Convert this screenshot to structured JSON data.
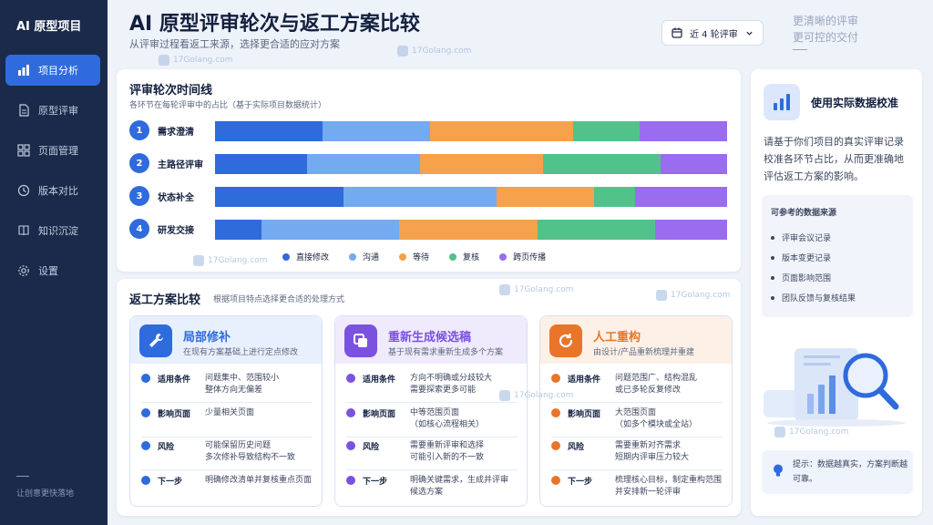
{
  "app": {
    "brand": "AI 原型项目",
    "slogan": "让创意更快落地"
  },
  "nav": [
    {
      "label": "项目分析",
      "icon": "bar-chart-icon",
      "active": true
    },
    {
      "label": "原型评审",
      "icon": "document-icon",
      "active": false
    },
    {
      "label": "页面管理",
      "icon": "grid-icon",
      "active": false
    },
    {
      "label": "版本对比",
      "icon": "history-icon",
      "active": false
    },
    {
      "label": "知识沉淀",
      "icon": "book-icon",
      "active": false
    },
    {
      "label": "设置",
      "icon": "gear-icon",
      "active": false
    }
  ],
  "header": {
    "title": "AI 原型评审轮次与返工方案比较",
    "subtitle": "从评审过程看返工来源，选择更合适的应对方案",
    "round_select": "近 4 轮评审",
    "tagline": [
      "更清晰的评审",
      "更可控的交付"
    ]
  },
  "watermark": "17Golang.com",
  "timeline": {
    "title": "评审轮次时间线",
    "subtitle": "各环节在每轮评审中的占比（基于实际项目数据统计）"
  },
  "chart_data": {
    "type": "bar",
    "stacked": true,
    "orientation": "horizontal",
    "categories": [
      "需求澄清",
      "主路径评审",
      "状态补全",
      "研发交接"
    ],
    "series": [
      {
        "name": "直接修改",
        "color": "#2f6bdc",
        "values": [
          21,
          18,
          25,
          9
        ]
      },
      {
        "name": "沟通",
        "color": "#74aaf0",
        "values": [
          21,
          22,
          30,
          27
        ]
      },
      {
        "name": "等待",
        "color": "#f6a14b",
        "values": [
          28,
          24,
          19,
          27
        ]
      },
      {
        "name": "复核",
        "color": "#52c28b",
        "values": [
          13,
          23,
          8,
          23
        ]
      },
      {
        "name": "跨页传播",
        "color": "#9a6cf0",
        "values": [
          17,
          13,
          18,
          14
        ]
      }
    ],
    "legend": "bottom"
  },
  "compare": {
    "title": "返工方案比较",
    "subtitle": "根据项目特点选择更合适的处理方式",
    "options": [
      {
        "title": "局部修补",
        "desc": "在现有方案基础上进行定点修改",
        "icon": "wrench-icon",
        "color": "#2f6bdc",
        "rows": [
          {
            "key": "适用条件",
            "value": "问题集中、范围较小\n整体方向无偏差"
          },
          {
            "key": "影响页面",
            "value": "少量相关页面"
          },
          {
            "key": "风险",
            "value": "可能保留历史问题\n多次修补导致结构不一致"
          },
          {
            "key": "下一步",
            "value": "明确修改清单并复核重点页面"
          }
        ]
      },
      {
        "title": "重新生成候选稿",
        "desc": "基于现有需求重新生成多个方案",
        "icon": "copy-icon",
        "color": "#7b52e0",
        "rows": [
          {
            "key": "适用条件",
            "value": "方向不明确或分歧较大\n需要探索更多可能"
          },
          {
            "key": "影响页面",
            "value": "中等范围页面\n（如核心流程相关）"
          },
          {
            "key": "风险",
            "value": "需要重新评审和选择\n可能引入新的不一致"
          },
          {
            "key": "下一步",
            "value": "明确关键需求，生成并评审\n候选方案"
          }
        ]
      },
      {
        "title": "人工重构",
        "desc": "由设计/产品重新梳理并重建",
        "icon": "refresh-icon",
        "color": "#e9752a",
        "rows": [
          {
            "key": "适用条件",
            "value": "问题范围广、结构混乱\n或已多轮反复修改"
          },
          {
            "key": "影响页面",
            "value": "大范围页面\n（如多个模块或全站）"
          },
          {
            "key": "风险",
            "value": "需要重新对齐需求\n短期内评审压力较大"
          },
          {
            "key": "下一步",
            "value": "梳理核心目标，制定重构范围\n并安排新一轮评审"
          }
        ]
      }
    ]
  },
  "side": {
    "title": "使用实际数据校准",
    "body": "请基于你们项目的真实评审记录校准各环节占比，从而更准确地评估返工方案的影响。",
    "sources_title": "可参考的数据来源",
    "sources": [
      "评审会议记录",
      "版本变更记录",
      "页面影响范围",
      "团队反馈与复核结果"
    ],
    "tip": "提示：数据越真实，方案判断越可靠。"
  }
}
